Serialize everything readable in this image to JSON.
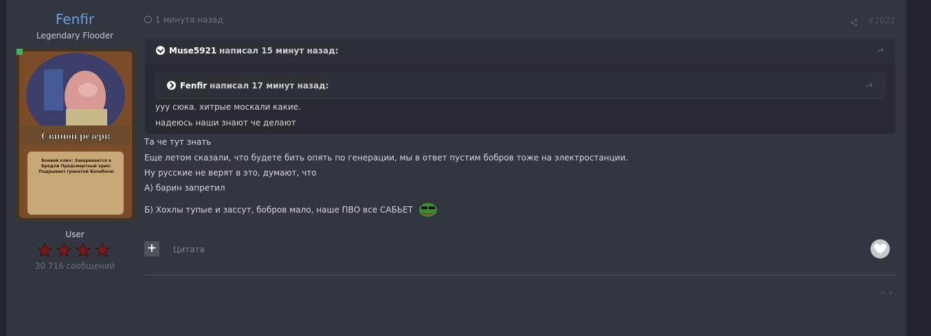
{
  "author": {
    "name": "Fenfir",
    "title": "Legendary Flooder",
    "avatar_caption": "Свиной резерв",
    "avatar_text": "Боевой клич: Заваривается в Бредли Предсмертный хрип: Подрывает гранатой Балабосю",
    "group": "User",
    "post_count": "30 716 сообщений"
  },
  "post": {
    "time": "1 минута назад",
    "number": "#2022",
    "quote": {
      "author": "Muse5921",
      "said": "написал 15 минут назад:",
      "nested": {
        "author": "Fenfir",
        "said": "написал 17 минут назад:"
      },
      "lines": [
        "ууу сюка. хитрые москали какие.",
        "надеюсь наши знают че делают"
      ]
    },
    "lines": [
      "Та че тут знать",
      "Еще летом сказали, что будете бить опять по генерации, мы в ответ пустим бобров тоже на электростанции.",
      "Ну русские не верят в это, думают, что",
      "А) барин запретил",
      "Б) Хохлы тупые и зассут, бобров мало, наше ПВО все САБЬЕТ"
    ],
    "quote_button": "Цитата",
    "plus_label": "+",
    "close_label": "✕ ▾"
  },
  "colors": {
    "author_name": "#6f9ee0",
    "panel": "#32363e",
    "background": "#22252c"
  }
}
